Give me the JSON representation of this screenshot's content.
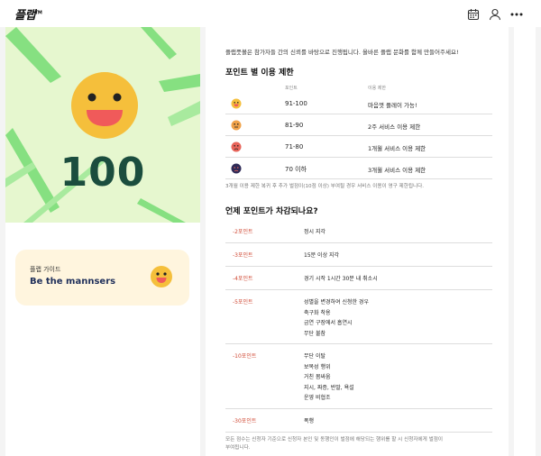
{
  "header": {
    "logo": "플랩",
    "logo_mark": "TM",
    "icons": [
      "calendar-icon",
      "user-icon",
      "more-icon"
    ]
  },
  "hero": {
    "score": "100",
    "bg_color": "#e6f7cf",
    "stripe_color": "#86e081",
    "face_color": "#f5bf3b"
  },
  "guide": {
    "label": "플랩 가이드",
    "title": "Be the mannsers"
  },
  "main": {
    "intro": "플랩풋볼은 참가자들 간의 신뢰를 바탕으로 진행됩니다. 올바른 플랩 문화를 함께 만들어주세요!",
    "points_title": "포인트 별 이용 제한",
    "col_point": "포인트",
    "col_limit": "이용 제한",
    "point_rows": [
      {
        "range": "91-100",
        "limit": "마음껏 플레이 가능!",
        "face": "happy",
        "color": "#f5bf3b"
      },
      {
        "range": "81-90",
        "limit": "2주 서비스 이용 제한",
        "face": "neutral",
        "color": "#f0a24a"
      },
      {
        "range": "71-80",
        "limit": "1개월 서비스 이용 제한",
        "face": "sad",
        "color": "#e8645a"
      },
      {
        "range": "70 이하",
        "limit": "3개월 서비스 이용 제한",
        "face": "angry",
        "color": "#2e2a57"
      }
    ],
    "point_note": "3개월 이용 제한 복귀 후 추가 벌점이(10점 이상) 부여될 경우 서비스 이용이 영구 제한됩니다.",
    "deduct_title": "언제 포인트가 차감되나요?",
    "deduct_rows": [
      {
        "points": "-2포인트",
        "reasons": [
          "정시 지각"
        ]
      },
      {
        "points": "-3포인트",
        "reasons": [
          "15분 이상 지각"
        ]
      },
      {
        "points": "-4포인트",
        "reasons": [
          "경기 시작 1시간 30분 내 취소시"
        ]
      },
      {
        "points": "-5포인트",
        "reasons": [
          "성별을 변경하여 신청한 경우",
          "축구화 착용",
          "금연 구장에서 흡연시",
          "무단 불참"
        ]
      },
      {
        "points": "-10포인트",
        "reasons": [
          "무단 이탈",
          "보복성 행위",
          "거친 몸싸움",
          "지시, 짜증, 반말, 욕설",
          "운영 비협조"
        ]
      },
      {
        "points": "-30포인트",
        "reasons": [
          "폭행"
        ]
      }
    ],
    "deduct_note_1": "모든 점수는 신청자 기준으로 신청자 본인 및 동행인이 벌점에 해당되는 행위를 할 시 신청자에게 벌점이",
    "deduct_note_2": "부여됩니다."
  }
}
